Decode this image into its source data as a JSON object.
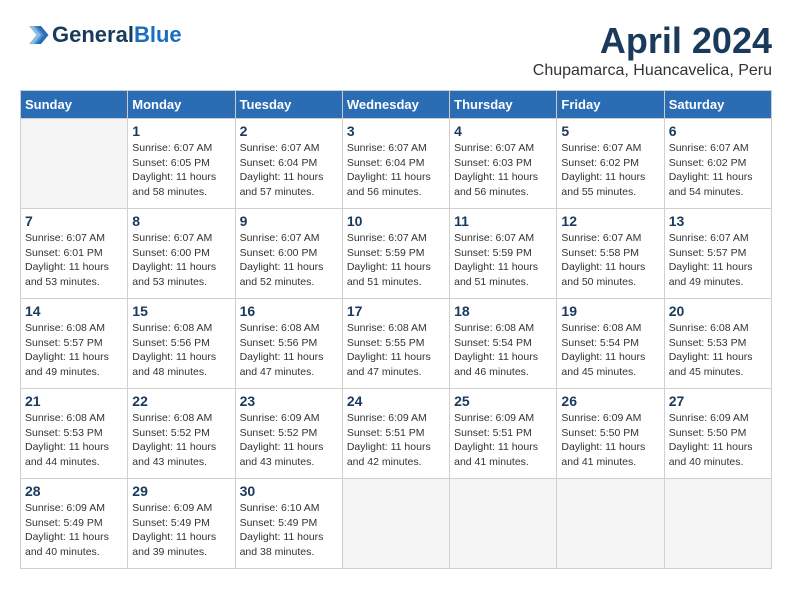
{
  "header": {
    "logo_line1": "General",
    "logo_line2": "Blue",
    "month_title": "April 2024",
    "location": "Chupamarca, Huancavelica, Peru"
  },
  "days_of_week": [
    "Sunday",
    "Monday",
    "Tuesday",
    "Wednesday",
    "Thursday",
    "Friday",
    "Saturday"
  ],
  "weeks": [
    [
      {
        "day": "",
        "info": ""
      },
      {
        "day": "1",
        "info": "Sunrise: 6:07 AM\nSunset: 6:05 PM\nDaylight: 11 hours\nand 58 minutes."
      },
      {
        "day": "2",
        "info": "Sunrise: 6:07 AM\nSunset: 6:04 PM\nDaylight: 11 hours\nand 57 minutes."
      },
      {
        "day": "3",
        "info": "Sunrise: 6:07 AM\nSunset: 6:04 PM\nDaylight: 11 hours\nand 56 minutes."
      },
      {
        "day": "4",
        "info": "Sunrise: 6:07 AM\nSunset: 6:03 PM\nDaylight: 11 hours\nand 56 minutes."
      },
      {
        "day": "5",
        "info": "Sunrise: 6:07 AM\nSunset: 6:02 PM\nDaylight: 11 hours\nand 55 minutes."
      },
      {
        "day": "6",
        "info": "Sunrise: 6:07 AM\nSunset: 6:02 PM\nDaylight: 11 hours\nand 54 minutes."
      }
    ],
    [
      {
        "day": "7",
        "info": "Sunrise: 6:07 AM\nSunset: 6:01 PM\nDaylight: 11 hours\nand 53 minutes."
      },
      {
        "day": "8",
        "info": "Sunrise: 6:07 AM\nSunset: 6:00 PM\nDaylight: 11 hours\nand 53 minutes."
      },
      {
        "day": "9",
        "info": "Sunrise: 6:07 AM\nSunset: 6:00 PM\nDaylight: 11 hours\nand 52 minutes."
      },
      {
        "day": "10",
        "info": "Sunrise: 6:07 AM\nSunset: 5:59 PM\nDaylight: 11 hours\nand 51 minutes."
      },
      {
        "day": "11",
        "info": "Sunrise: 6:07 AM\nSunset: 5:59 PM\nDaylight: 11 hours\nand 51 minutes."
      },
      {
        "day": "12",
        "info": "Sunrise: 6:07 AM\nSunset: 5:58 PM\nDaylight: 11 hours\nand 50 minutes."
      },
      {
        "day": "13",
        "info": "Sunrise: 6:07 AM\nSunset: 5:57 PM\nDaylight: 11 hours\nand 49 minutes."
      }
    ],
    [
      {
        "day": "14",
        "info": "Sunrise: 6:08 AM\nSunset: 5:57 PM\nDaylight: 11 hours\nand 49 minutes."
      },
      {
        "day": "15",
        "info": "Sunrise: 6:08 AM\nSunset: 5:56 PM\nDaylight: 11 hours\nand 48 minutes."
      },
      {
        "day": "16",
        "info": "Sunrise: 6:08 AM\nSunset: 5:56 PM\nDaylight: 11 hours\nand 47 minutes."
      },
      {
        "day": "17",
        "info": "Sunrise: 6:08 AM\nSunset: 5:55 PM\nDaylight: 11 hours\nand 47 minutes."
      },
      {
        "day": "18",
        "info": "Sunrise: 6:08 AM\nSunset: 5:54 PM\nDaylight: 11 hours\nand 46 minutes."
      },
      {
        "day": "19",
        "info": "Sunrise: 6:08 AM\nSunset: 5:54 PM\nDaylight: 11 hours\nand 45 minutes."
      },
      {
        "day": "20",
        "info": "Sunrise: 6:08 AM\nSunset: 5:53 PM\nDaylight: 11 hours\nand 45 minutes."
      }
    ],
    [
      {
        "day": "21",
        "info": "Sunrise: 6:08 AM\nSunset: 5:53 PM\nDaylight: 11 hours\nand 44 minutes."
      },
      {
        "day": "22",
        "info": "Sunrise: 6:08 AM\nSunset: 5:52 PM\nDaylight: 11 hours\nand 43 minutes."
      },
      {
        "day": "23",
        "info": "Sunrise: 6:09 AM\nSunset: 5:52 PM\nDaylight: 11 hours\nand 43 minutes."
      },
      {
        "day": "24",
        "info": "Sunrise: 6:09 AM\nSunset: 5:51 PM\nDaylight: 11 hours\nand 42 minutes."
      },
      {
        "day": "25",
        "info": "Sunrise: 6:09 AM\nSunset: 5:51 PM\nDaylight: 11 hours\nand 41 minutes."
      },
      {
        "day": "26",
        "info": "Sunrise: 6:09 AM\nSunset: 5:50 PM\nDaylight: 11 hours\nand 41 minutes."
      },
      {
        "day": "27",
        "info": "Sunrise: 6:09 AM\nSunset: 5:50 PM\nDaylight: 11 hours\nand 40 minutes."
      }
    ],
    [
      {
        "day": "28",
        "info": "Sunrise: 6:09 AM\nSunset: 5:49 PM\nDaylight: 11 hours\nand 40 minutes."
      },
      {
        "day": "29",
        "info": "Sunrise: 6:09 AM\nSunset: 5:49 PM\nDaylight: 11 hours\nand 39 minutes."
      },
      {
        "day": "30",
        "info": "Sunrise: 6:10 AM\nSunset: 5:49 PM\nDaylight: 11 hours\nand 38 minutes."
      },
      {
        "day": "",
        "info": ""
      },
      {
        "day": "",
        "info": ""
      },
      {
        "day": "",
        "info": ""
      },
      {
        "day": "",
        "info": ""
      }
    ]
  ]
}
